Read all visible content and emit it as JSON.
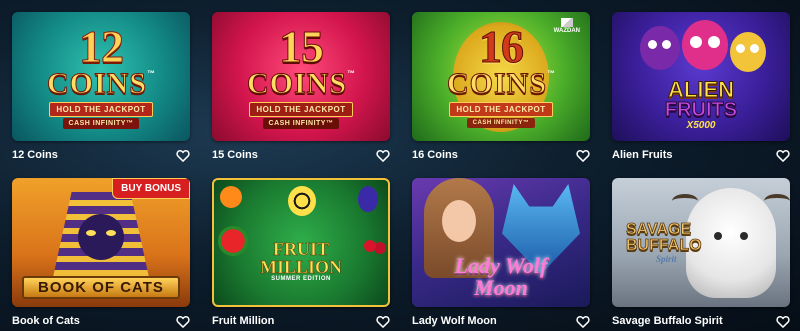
{
  "games": [
    {
      "name": "12 Coins"
    },
    {
      "name": "15 Coins"
    },
    {
      "name": "16 Coins"
    },
    {
      "name": "Alien Fruits"
    },
    {
      "name": "Book of Cats"
    },
    {
      "name": "Fruit Million"
    },
    {
      "name": "Lady Wolf Moon"
    },
    {
      "name": "Savage Buffalo Spirit"
    }
  ],
  "art": {
    "coins12": {
      "num": "12",
      "word": "COINS",
      "tm": "™",
      "line1": "HOLD THE JACKPOT",
      "line2": "CASH INFINITY™"
    },
    "coins15": {
      "num": "15",
      "word": "COINS",
      "tm": "™",
      "line1": "HOLD THE JACKPOT",
      "line2": "CASH INFINITY™"
    },
    "coins16": {
      "num": "16",
      "word": "COINS",
      "tm": "™",
      "line1": "HOLD THE JACKPOT",
      "line2": "CASH INFINITY™",
      "provider": "WAZDAN"
    },
    "alien": {
      "title1": "ALIEN",
      "title2": "FRUITS",
      "multiplier": "X5000"
    },
    "cats": {
      "badge": "BUY BONUS",
      "title": "BOOK OF CATS"
    },
    "fruit": {
      "title1": "FRUIT",
      "title2": "MILLION",
      "subtitle": "SUMMER EDITION"
    },
    "wolf": {
      "title1": "Lady Wolf",
      "title2": "Moon"
    },
    "buffalo": {
      "title1": "SAVAGE",
      "title2": "BUFFALO",
      "title3": "Spirit"
    }
  },
  "colors": {
    "heart": "#ffffff",
    "caption": "#ffffff"
  }
}
